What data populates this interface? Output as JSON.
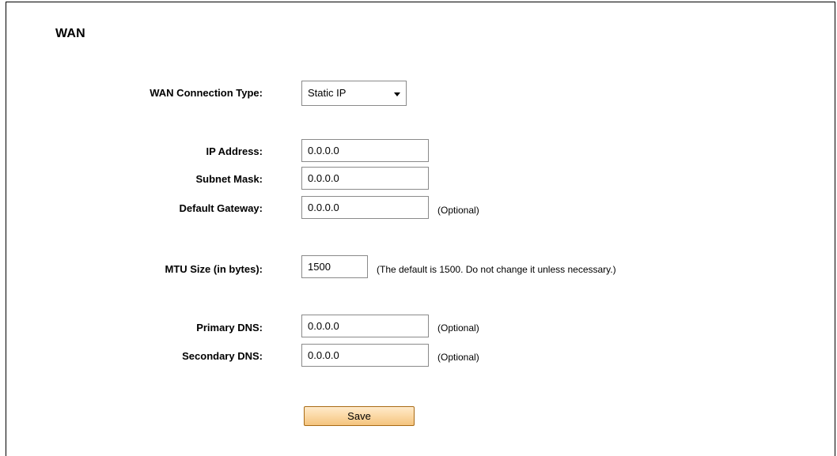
{
  "page": {
    "title": "WAN"
  },
  "form": {
    "connection_type": {
      "label": "WAN Connection Type:",
      "value": "Static IP"
    },
    "ip_address": {
      "label": "IP Address:",
      "value": "0.0.0.0"
    },
    "subnet_mask": {
      "label": "Subnet Mask:",
      "value": "0.0.0.0"
    },
    "default_gateway": {
      "label": "Default Gateway:",
      "value": "0.0.0.0",
      "hint": "(Optional)"
    },
    "mtu_size": {
      "label": "MTU Size (in bytes):",
      "value": "1500",
      "hint": "(The default is 1500. Do not change it unless necessary.)"
    },
    "primary_dns": {
      "label": "Primary DNS:",
      "value": "0.0.0.0",
      "hint": "(Optional)"
    },
    "secondary_dns": {
      "label": "Secondary DNS:",
      "value": "0.0.0.0",
      "hint": "(Optional)"
    },
    "save_label": "Save"
  },
  "colors": {
    "button_fill": "#fbd8a4",
    "button_border": "#a86a14",
    "field_border": "#8a8a8a"
  },
  "icons": {
    "dropdown": "caret-down-icon"
  }
}
